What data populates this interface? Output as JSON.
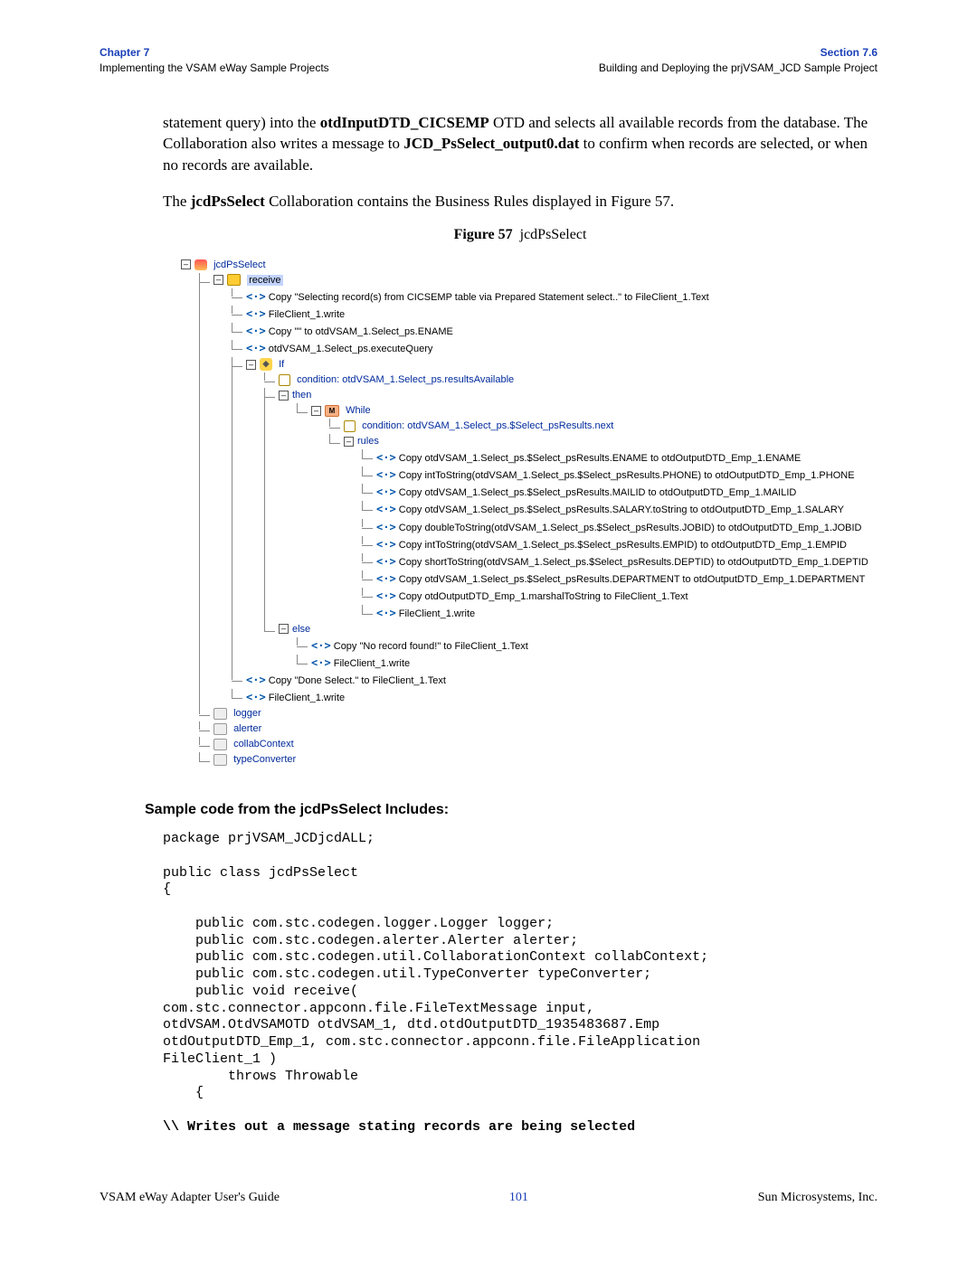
{
  "header": {
    "chapter_label": "Chapter 7",
    "chapter_title": "Implementing the VSAM eWay Sample Projects",
    "section_label": "Section 7.6",
    "section_title": "Building and Deploying the prjVSAM_JCD Sample Project"
  },
  "paras": {
    "p1a": "statement query) into the ",
    "p1b": "otdInputDTD_CICSEMP",
    "p1c": " OTD and selects all available records from the database. The Collaboration also writes a message to ",
    "p1d": "JCD_PsSelect_output0.dat",
    "p1e": " to confirm when records are selected, or when no records are available.",
    "p2a": "The ",
    "p2b": "jcdPsSelect",
    "p2c": " Collaboration contains the Business Rules displayed in Figure 57."
  },
  "figure": {
    "label": "Figure 57",
    "title": "jcdPsSelect"
  },
  "tree": {
    "root": "jcdPsSelect",
    "receive": "receive",
    "r1": "Copy \"Selecting record(s) from CICSEMP table via Prepared Statement select..\" to FileClient_1.Text",
    "r2": "FileClient_1.write",
    "r3": "Copy \"\" to otdVSAM_1.Select_ps.ENAME",
    "r4": "otdVSAM_1.Select_ps.executeQuery",
    "if": "If",
    "cond1": "condition: otdVSAM_1.Select_ps.resultsAvailable",
    "then": "then",
    "while": "While",
    "cond2": "condition: otdVSAM_1.Select_ps.$Select_psResults.next",
    "rules": "rules",
    "c1": "Copy otdVSAM_1.Select_ps.$Select_psResults.ENAME to otdOutputDTD_Emp_1.ENAME",
    "c2": "Copy intToString(otdVSAM_1.Select_ps.$Select_psResults.PHONE) to otdOutputDTD_Emp_1.PHONE",
    "c3": "Copy otdVSAM_1.Select_ps.$Select_psResults.MAILID to otdOutputDTD_Emp_1.MAILID",
    "c4": "Copy otdVSAM_1.Select_ps.$Select_psResults.SALARY.toString to otdOutputDTD_Emp_1.SALARY",
    "c5": "Copy doubleToString(otdVSAM_1.Select_ps.$Select_psResults.JOBID) to otdOutputDTD_Emp_1.JOBID",
    "c6": "Copy intToString(otdVSAM_1.Select_ps.$Select_psResults.EMPID) to otdOutputDTD_Emp_1.EMPID",
    "c7": "Copy shortToString(otdVSAM_1.Select_ps.$Select_psResults.DEPTID) to otdOutputDTD_Emp_1.DEPTID",
    "c8": "Copy otdVSAM_1.Select_ps.$Select_psResults.DEPARTMENT to otdOutputDTD_Emp_1.DEPARTMENT",
    "c9": "Copy otdOutputDTD_Emp_1.marshalToString to FileClient_1.Text",
    "c10": "FileClient_1.write",
    "else": "else",
    "e1": "Copy \"No record found!\" to FileClient_1.Text",
    "e2": "FileClient_1.write",
    "r5": "Copy \"Done Select.\" to FileClient_1.Text",
    "r6": "FileClient_1.write",
    "logger": "logger",
    "alerter": "alerter",
    "collab": "collabContext",
    "typec": "typeConverter"
  },
  "subhead": "Sample code from the jcdPsSelect Includes:",
  "code1": "package prjVSAM_JCDjcdALL;\n\npublic class jcdPsSelect\n{\n\n    public com.stc.codegen.logger.Logger logger;\n    public com.stc.codegen.alerter.Alerter alerter;\n    public com.stc.codegen.util.CollaborationContext collabContext;\n    public com.stc.codegen.util.TypeConverter typeConverter;\n    public void receive( \ncom.stc.connector.appconn.file.FileTextMessage input, \notdVSAM.OtdVSAMOTD otdVSAM_1, dtd.otdOutputDTD_1935483687.Emp \notdOutputDTD_Emp_1, com.stc.connector.appconn.file.FileApplication \nFileClient_1 )\n        throws Throwable\n    {",
  "code2": "\\\\ Writes out a message stating records are being selected",
  "footer": {
    "left": "VSAM eWay Adapter User's Guide",
    "mid": "101",
    "right": "Sun Microsystems, Inc."
  }
}
